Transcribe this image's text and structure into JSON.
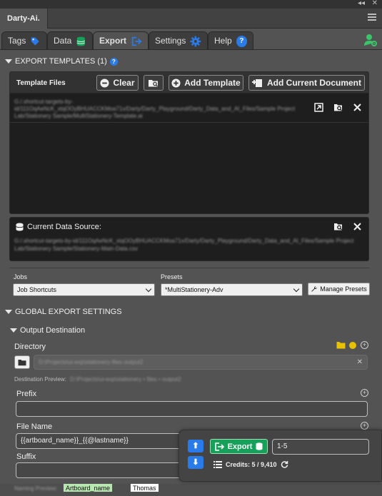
{
  "window": {
    "panel_title": "Darty-Ai.",
    "collapse_glyph": "◂◂",
    "close_glyph": "✕"
  },
  "tabs": [
    {
      "label": "Tags",
      "icon": "tag-icon",
      "active": false
    },
    {
      "label": "Data",
      "icon": "database-icon",
      "active": false
    },
    {
      "label": "Export",
      "icon": "export-icon",
      "active": true
    },
    {
      "label": "Settings",
      "icon": "gear-icon",
      "active": false
    },
    {
      "label": "Help",
      "icon": "help-icon",
      "active": false
    }
  ],
  "export_templates": {
    "heading": "EXPORT TEMPLATES (1)",
    "help_glyph": "?",
    "files_label": "Template Files",
    "clear_label": "Clear",
    "add_template_label": "Add Template",
    "add_current_label": "Add Current Document",
    "template_path": "G:/.shortcut-targets-by-id/111OqAeNcK_xtqOOyBHUACCKMoa71x/Darty/Darty_Playground/Darty_Data_and_AI_Files/Sample Project Lab/Stationery Sample/MultiStationery-Template.ai"
  },
  "data_source": {
    "label": "Current Data Source:",
    "path": "G:/.shortcut-targets-by-id/111OqAeNcK_xtqOOyBHUACCKMoa71x/Darty/Darty_Playground/Darty_Data_and_AI_Files/Sample Project Lab/Stationery Sample/Stationery-Main-Data.csv"
  },
  "jobs": {
    "label": "Jobs",
    "value": "Job Shortcuts"
  },
  "presets": {
    "label": "Presets",
    "value": "*MultiStationery-Adv",
    "manage_label": "Manage Presets"
  },
  "global_settings": {
    "heading": "GLOBAL EXPORT SETTINGS",
    "output_heading": "Output Destination",
    "directory_label": "Directory",
    "directory_value": "D:\\Projects\\ui-exp\\stationery-files-output2",
    "clear_glyph": "✕",
    "preview_label": "Destination Preview:",
    "preview_value": "D:\\Projects\\ui-exp\\stationery • files • output2",
    "prefix_label": "Prefix",
    "prefix_value": "",
    "filename_label": "File Name",
    "filename_value": "{{artboard_name}}_{{@lastname}}",
    "suffix_label": "Suffix",
    "suffix_value": "",
    "naming_preview_label": "Naming Preview:",
    "naming_chip_1": "Artboard_name",
    "naming_chip_2": "Thomas"
  },
  "export_panel": {
    "up_glyph": "⬆",
    "down_glyph": "⬇",
    "export_label": "Export",
    "range_value": "1-5",
    "credits_text": "Credits: 5 / 9,410"
  },
  "colors": {
    "accent_blue": "#2a7bea",
    "export_green": "#17a05a",
    "user_icon_green": "#3cc46a",
    "dot_yellow": "#e8c200"
  }
}
